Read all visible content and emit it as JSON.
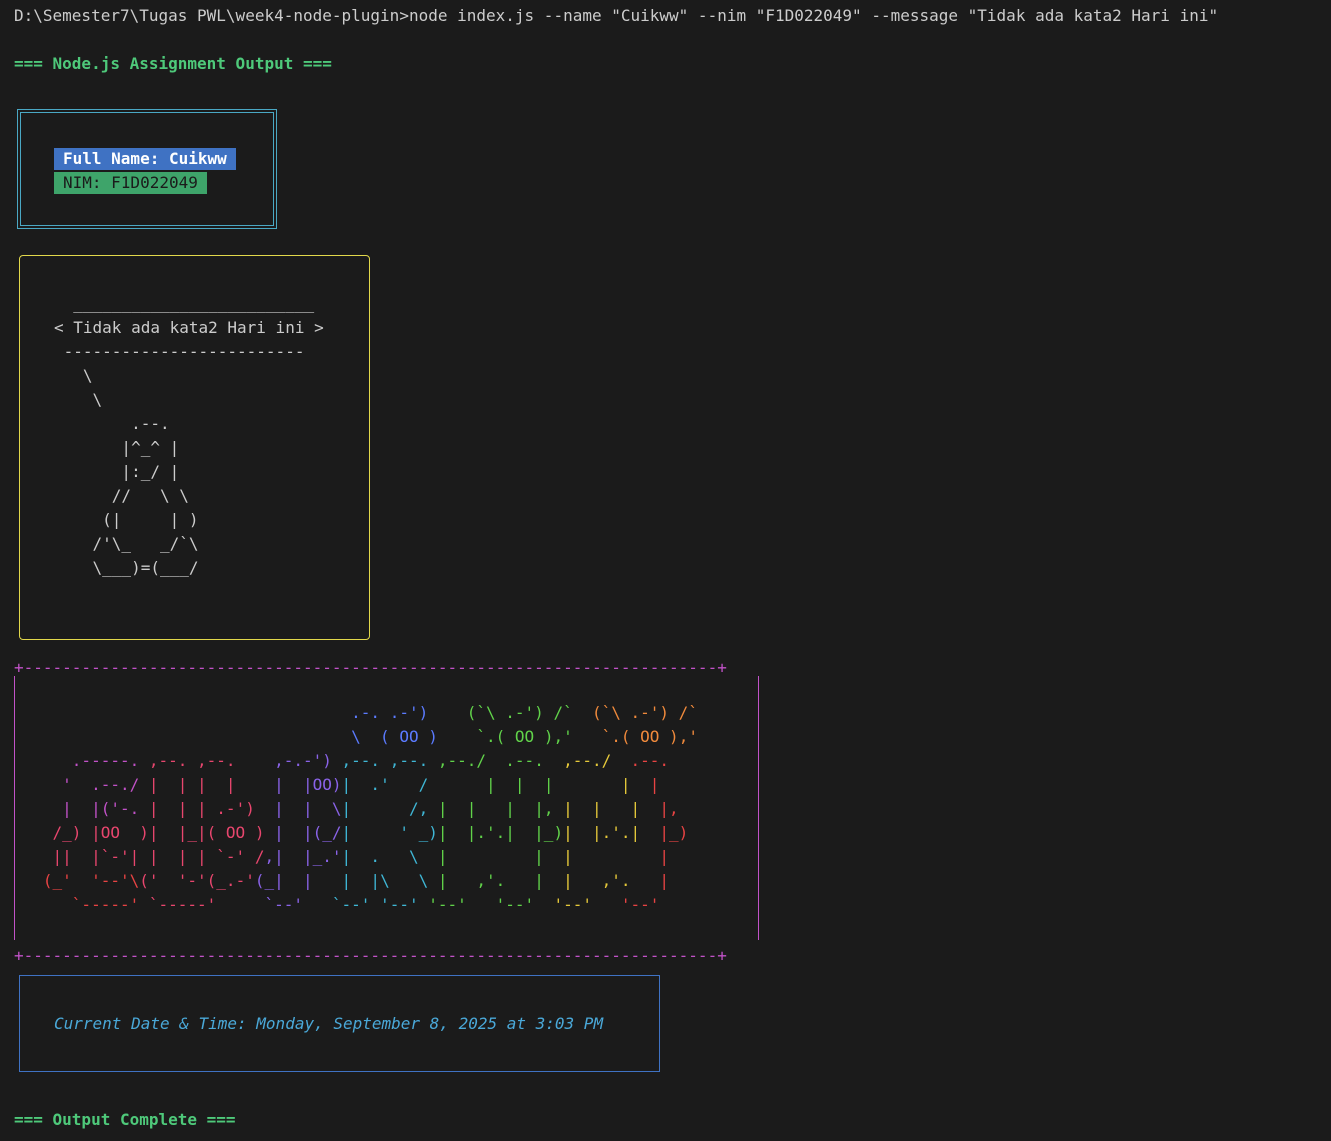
{
  "terminal": {
    "command_line": "D:\\Semester7\\Tugas PWL\\week4-node-plugin>node index.js --name \"Cuikww\" --nim \"F1D022049\" --message \"Tidak ada kata2 Hari ini\"",
    "header_top": "=== Node.js Assignment Output ===",
    "header_bottom": "=== Output Complete ==="
  },
  "identity_box": {
    "full_name": "Full Name: Cuikww",
    "nim": "NIM: F1D022049"
  },
  "cowsay": {
    "message": "Tidak ada kata2 Hari ini",
    "art": "  _________________________\n< Tidak ada kata2 Hari ini >\n -------------------------\n   \\\n    \\\n        .--.\n       |^_^ |\n       |:_/ |\n      //   \\ \\\n     (|     | )\n    /'\\_   _/`\\\n    \\___)=(___/"
  },
  "banner": {
    "text": "CUIKWW",
    "border_top": "+------------------------------------------------------------------------+",
    "border_bottom": "+------------------------------------------------------------------------+"
  },
  "datetime_box": {
    "text": "Current Date & Time: Monday, September 8, 2025 at 3:03 PM"
  },
  "colors": {
    "background": "#1b1b1b",
    "header_green": "#4ec97a",
    "name_bg": "#3f72c3",
    "nim_bg": "#3ea46a",
    "cow_border": "#e2d84b",
    "banner_border": "#c252c8",
    "date_text": "#4aa8d8"
  }
}
